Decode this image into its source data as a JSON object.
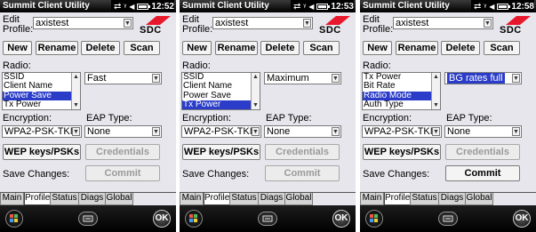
{
  "screens": [
    {
      "title": "Summit Client Utility",
      "clock": "12:52",
      "edit_label": "Edit",
      "profile_label": "Profile:",
      "profile_value": "axistest",
      "logo_text": "SDC",
      "buttons": {
        "new": "New",
        "rename": "Rename",
        "delete": "Delete",
        "scan": "Scan"
      },
      "radio_label": "Radio:",
      "radio_items": [
        "SSID",
        "Client Name",
        "Power Save",
        "Tx Power"
      ],
      "radio_selected_index": 2,
      "value_combo": "Fast",
      "value_highlighted": false,
      "encryption_label": "Encryption:",
      "encryption_value": "WPA2-PSK-TKIP",
      "eap_label": "EAP Type:",
      "eap_value": "None",
      "wep_button": "WEP keys/PSKs",
      "credentials_button": "Credentials",
      "save_label": "Save Changes:",
      "commit_button": "Commit",
      "commit_enabled": false,
      "tabs": [
        "Main",
        "Profile",
        "Status",
        "Diags",
        "Global"
      ],
      "active_tab": "Profile",
      "ok_label": "OK"
    },
    {
      "title": "Summit Client Utility",
      "clock": "12:53",
      "edit_label": "Edit",
      "profile_label": "Profile:",
      "profile_value": "axistest",
      "logo_text": "SDC",
      "buttons": {
        "new": "New",
        "rename": "Rename",
        "delete": "Delete",
        "scan": "Scan"
      },
      "radio_label": "Radio:",
      "radio_items": [
        "SSID",
        "Client Name",
        "Power Save",
        "Tx Power"
      ],
      "radio_selected_index": 3,
      "value_combo": "Maximum",
      "value_highlighted": false,
      "encryption_label": "Encryption:",
      "encryption_value": "WPA2-PSK-TKIP",
      "eap_label": "EAP Type:",
      "eap_value": "None",
      "wep_button": "WEP keys/PSKs",
      "credentials_button": "Credentials",
      "save_label": "Save Changes:",
      "commit_button": "Commit",
      "commit_enabled": false,
      "tabs": [
        "Main",
        "Profile",
        "Status",
        "Diags",
        "Global"
      ],
      "active_tab": "Profile",
      "ok_label": "OK"
    },
    {
      "title": "Summit Client Utility",
      "clock": "12:58",
      "edit_label": "Edit",
      "profile_label": "Profile:",
      "profile_value": "axistest",
      "logo_text": "SDC",
      "buttons": {
        "new": "New",
        "rename": "Rename",
        "delete": "Delete",
        "scan": "Scan"
      },
      "radio_label": "Radio:",
      "radio_items": [
        "Tx Power",
        "Bit Rate",
        "Radio Mode",
        "Auth Type"
      ],
      "radio_selected_index": 2,
      "value_combo": "BG rates full",
      "value_highlighted": true,
      "encryption_label": "Encryption:",
      "encryption_value": "WPA2-PSK-TKIP",
      "eap_label": "EAP Type:",
      "eap_value": "None",
      "wep_button": "WEP keys/PSKs",
      "credentials_button": "Credentials",
      "save_label": "Save Changes:",
      "commit_button": "Commit",
      "commit_enabled": true,
      "tabs": [
        "Main",
        "Profile",
        "Status",
        "Diags",
        "Global"
      ],
      "active_tab": "Profile",
      "ok_label": "OK"
    }
  ],
  "colors": {
    "selection": "#2a3cc8",
    "logo_red": "#e8182c",
    "background": "#e6e6ec"
  }
}
